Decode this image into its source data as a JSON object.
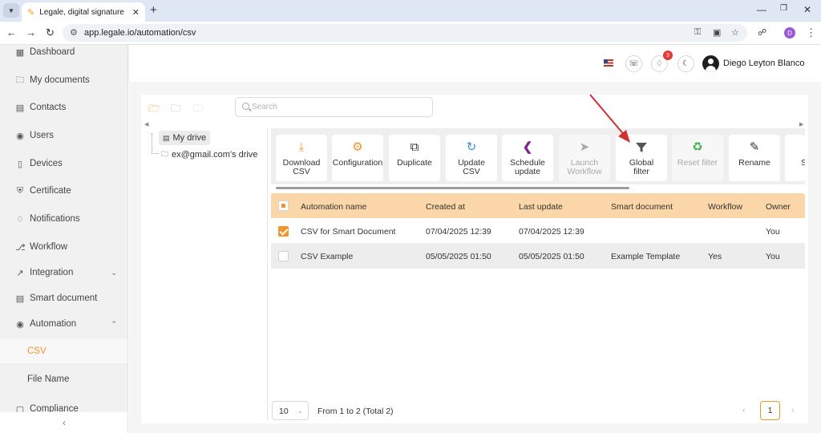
{
  "browser": {
    "tab_title": "Legale, digital signature",
    "url": "app.legale.io/automation/csv",
    "profile_initial": "D"
  },
  "sidebar": {
    "items": [
      {
        "label": "Dashboard",
        "icon": "dashboard-icon"
      },
      {
        "label": "My documents",
        "icon": "folder-icon"
      },
      {
        "label": "Contacts",
        "icon": "contacts-icon"
      },
      {
        "label": "Users",
        "icon": "user-icon"
      },
      {
        "label": "Devices",
        "icon": "device-icon"
      },
      {
        "label": "Certificate",
        "icon": "shield-check-icon"
      },
      {
        "label": "Notifications",
        "icon": "bell-icon"
      },
      {
        "label": "Workflow",
        "icon": "workflow-icon"
      },
      {
        "label": "Integration",
        "icon": "external-link-icon"
      },
      {
        "label": "Smart document",
        "icon": "smart-document-icon"
      },
      {
        "label": "Automation",
        "icon": "automation-icon"
      },
      {
        "label": "CSV",
        "icon": ""
      },
      {
        "label": "File Name",
        "icon": ""
      },
      {
        "label": "Compliance",
        "icon": "compliance-icon"
      }
    ],
    "active_item": "CSV"
  },
  "header": {
    "notification_count": "3",
    "user_name": "Diego Leyton Blanco"
  },
  "explorer": {
    "search_placeholder": "Search",
    "drives": [
      "My drive",
      "ex@gmail.com's drive"
    ],
    "selected_drive": "My drive"
  },
  "toolbar": {
    "buttons": [
      {
        "line1": "Download",
        "line2": "CSV",
        "icon": "download-icon",
        "color": "#f0942b",
        "enabled": true
      },
      {
        "line1": "Configuration",
        "line2": "",
        "icon": "gear-icon",
        "color": "#f0942b",
        "enabled": true
      },
      {
        "line1": "Duplicate",
        "line2": "",
        "icon": "duplicate-icon",
        "color": "#333333",
        "enabled": true
      },
      {
        "line1": "Update",
        "line2": "CSV",
        "icon": "refresh-icon",
        "color": "#3a8fd9",
        "enabled": true
      },
      {
        "line1": "Schedule",
        "line2": "update",
        "icon": "schedule-icon",
        "color": "#7b2a8c",
        "enabled": true
      },
      {
        "line1": "Launch",
        "line2": "Workflow",
        "icon": "rocket-icon",
        "color": "#a9a9a9",
        "enabled": false
      },
      {
        "line1": "Global",
        "line2": "filter",
        "icon": "filter-icon",
        "color": "#555555",
        "enabled": true
      },
      {
        "line1": "Reset filter",
        "line2": "",
        "icon": "recycle-icon",
        "color": "#3aa84a",
        "enabled": false
      },
      {
        "line1": "Rename",
        "line2": "",
        "icon": "pencil-icon",
        "color": "#333333",
        "enabled": true
      },
      {
        "line1": "S",
        "line2": "",
        "icon": "",
        "color": "#333333",
        "enabled": true
      }
    ]
  },
  "table": {
    "columns": [
      "Automation name",
      "Created at",
      "Last update",
      "Smart document",
      "Workflow",
      "Owner"
    ],
    "rows": [
      {
        "checked": true,
        "cells": [
          "CSV for Smart Document",
          "07/04/2025 12:39",
          "07/04/2025 12:39",
          "",
          "",
          "You"
        ]
      },
      {
        "checked": false,
        "cells": [
          "CSV Example",
          "05/05/2025 01:50",
          "05/05/2025 01:50",
          "Example Template",
          "Yes",
          "You"
        ]
      }
    ]
  },
  "pagination": {
    "page_size": "10",
    "range_text": "From 1 to 2 (Total 2)",
    "current_page": "1"
  },
  "colors": {
    "accent": "#f0942b",
    "table_header": "#fbd6a8",
    "annotation_arrow": "#d32f2f"
  }
}
